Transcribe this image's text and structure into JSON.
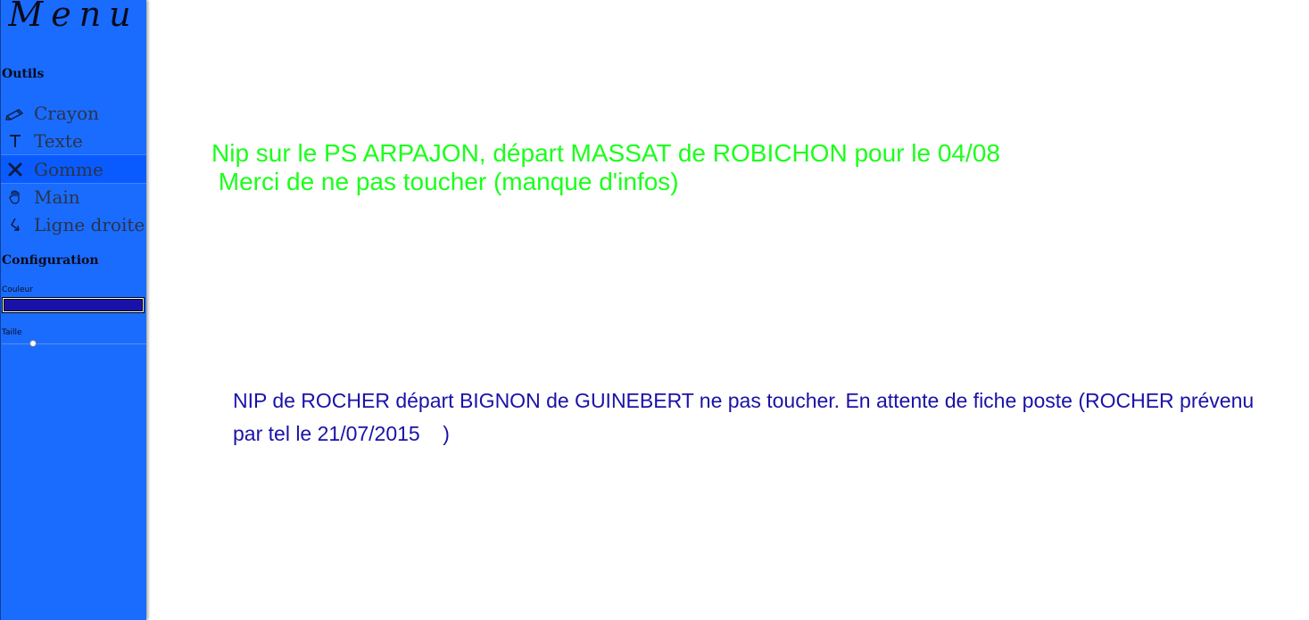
{
  "sidebar": {
    "title": "Menu",
    "tools_heading": "Outils",
    "tools": [
      {
        "label": "Crayon",
        "icon": "pencil-icon"
      },
      {
        "label": "Texte",
        "icon": "text-icon"
      },
      {
        "label": "Gomme",
        "icon": "eraser-icon",
        "active": true
      },
      {
        "label": "Main",
        "icon": "hand-icon"
      },
      {
        "label": "Ligne droite",
        "icon": "line-arrow-icon"
      }
    ],
    "config_heading": "Configuration",
    "color_label": "Couleur",
    "color_value": "#1a12a8",
    "size_label": "Taille",
    "size_value_fraction": 0.2
  },
  "canvas": {
    "note_green": {
      "text": "Nip sur le PS ARPAJON, départ MASSAT de ROBICHON pour le 04/08\n Merci de ne pas toucher (manque d'infos)",
      "color": "#1aff1a"
    },
    "note_blue": {
      "text": "NIP de ROCHER départ BIGNON de GUINEBERT ne pas toucher. En attente de fiche poste (ROCHER prévenu par tel le 21/07/2015    )",
      "color": "#1a12a8"
    }
  },
  "colors": {
    "sidebar_bg": "#1a6cff",
    "active_tool_bg": "#0a5bff"
  }
}
